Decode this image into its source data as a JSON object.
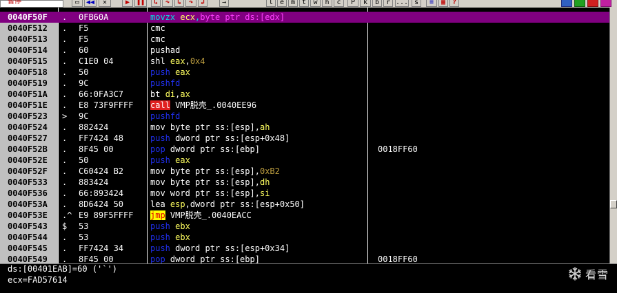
{
  "toolbar": {
    "status": "暂停",
    "buttons": [
      {
        "name": "open-icon",
        "glyph": "▭"
      },
      {
        "name": "rewind-icon",
        "glyph": "◀◀"
      },
      {
        "name": "close-icon",
        "glyph": "✕"
      },
      {
        "name": "run-icon",
        "glyph": "▶"
      },
      {
        "name": "pause-icon",
        "glyph": "❚❚"
      },
      {
        "name": "step-into-icon",
        "glyph": "↳"
      },
      {
        "name": "step-over-icon",
        "glyph": "↷"
      },
      {
        "name": "trace-into-icon",
        "glyph": "↳"
      },
      {
        "name": "trace-over-icon",
        "glyph": "↷"
      },
      {
        "name": "execute-till-return-icon",
        "glyph": "↲"
      },
      {
        "name": "goto-icon",
        "glyph": "→"
      },
      {
        "name": "log-button",
        "glyph": "l"
      },
      {
        "name": "memory-button",
        "glyph": "e"
      },
      {
        "name": "modules-button",
        "glyph": "m"
      },
      {
        "name": "threads-button",
        "glyph": "t"
      },
      {
        "name": "windows-button",
        "glyph": "w"
      },
      {
        "name": "handles-button",
        "glyph": "h"
      },
      {
        "name": "cpu-button",
        "glyph": "c"
      },
      {
        "name": "patches-button",
        "glyph": "P"
      },
      {
        "name": "callstack-button",
        "glyph": "k"
      },
      {
        "name": "breakpoints-button",
        "glyph": "b"
      },
      {
        "name": "references-button",
        "glyph": "r"
      },
      {
        "name": "more-button",
        "glyph": "..."
      },
      {
        "name": "source-button",
        "glyph": "s"
      },
      {
        "name": "options-icon",
        "glyph": "≡"
      },
      {
        "name": "appearance-icon",
        "glyph": "▦"
      },
      {
        "name": "help-icon",
        "glyph": "?"
      }
    ]
  },
  "disasm": {
    "rows": [
      {
        "addr": "0040F50F",
        "mark": ".",
        "hex": "0FB60A",
        "cmt": "",
        "selected": true,
        "cmd": [
          {
            "t": "movzx ",
            "c": "m-cyan"
          },
          {
            "t": "ecx",
            "c": "m-yellow"
          },
          {
            "t": ",",
            "c": "m-cyan"
          },
          {
            "t": "byte ptr ds:[edx]",
            "c": "m-mag"
          }
        ]
      },
      {
        "addr": "0040F512",
        "mark": ".",
        "hex": "F5",
        "cmt": "",
        "cmd": [
          {
            "t": "cmc",
            "c": "m-white"
          }
        ]
      },
      {
        "addr": "0040F513",
        "mark": ".",
        "hex": "F5",
        "cmt": "",
        "cmd": [
          {
            "t": "cmc",
            "c": "m-white"
          }
        ]
      },
      {
        "addr": "0040F514",
        "mark": ".",
        "hex": "60",
        "cmt": "",
        "cmd": [
          {
            "t": "pushad",
            "c": "m-white"
          }
        ]
      },
      {
        "addr": "0040F515",
        "mark": ".",
        "hex": "C1E0 04",
        "cmt": "",
        "cmd": [
          {
            "t": "shl ",
            "c": "m-white"
          },
          {
            "t": "eax",
            "c": "m-yellow"
          },
          {
            "t": ",",
            "c": "m-white"
          },
          {
            "t": "0x4",
            "c": "m-olive"
          }
        ]
      },
      {
        "addr": "0040F518",
        "mark": ".",
        "hex": "50",
        "cmt": "",
        "cmd": [
          {
            "t": "push ",
            "c": "m-blue"
          },
          {
            "t": "eax",
            "c": "m-yellow"
          }
        ]
      },
      {
        "addr": "0040F519",
        "mark": ".",
        "hex": "9C",
        "cmt": "",
        "cmd": [
          {
            "t": "pushfd",
            "c": "m-blue"
          }
        ]
      },
      {
        "addr": "0040F51A",
        "mark": ".",
        "hex": "66:0FA3C7",
        "cmt": "",
        "cmd": [
          {
            "t": "bt ",
            "c": "m-white"
          },
          {
            "t": "di",
            "c": "m-yellow"
          },
          {
            "t": ",",
            "c": "m-white"
          },
          {
            "t": "ax",
            "c": "m-yellow"
          }
        ]
      },
      {
        "addr": "0040F51E",
        "mark": ".",
        "hex": "E8 73F9FFFF",
        "cmt": "",
        "cmd": [
          {
            "t": "call",
            "c": "m-pill-red"
          },
          {
            "t": " VMP脱壳_.0040EE96",
            "c": "m-white"
          }
        ]
      },
      {
        "addr": "0040F523",
        "mark": ">",
        "hex": "9C",
        "cmt": "",
        "cmd": [
          {
            "t": "pushfd",
            "c": "m-blue"
          }
        ]
      },
      {
        "addr": "0040F524",
        "mark": ".",
        "hex": "882424",
        "cmt": "",
        "cmd": [
          {
            "t": "mov ",
            "c": "m-white"
          },
          {
            "t": "byte ptr ss:[esp]",
            "c": "m-white"
          },
          {
            "t": ",",
            "c": "m-white"
          },
          {
            "t": "ah",
            "c": "m-yellow"
          }
        ]
      },
      {
        "addr": "0040F527",
        "mark": ".",
        "hex": "FF7424 48",
        "cmt": "",
        "cmd": [
          {
            "t": "push ",
            "c": "m-blue"
          },
          {
            "t": "dword ptr ss:[esp+0x48]",
            "c": "m-white"
          }
        ]
      },
      {
        "addr": "0040F52B",
        "mark": ".",
        "hex": "8F45 00",
        "cmt": "0018FF60",
        "cmd": [
          {
            "t": "pop ",
            "c": "m-blue"
          },
          {
            "t": "dword ptr ss:[ebp]",
            "c": "m-white"
          }
        ]
      },
      {
        "addr": "0040F52E",
        "mark": ".",
        "hex": "50",
        "cmt": "",
        "cmd": [
          {
            "t": "push ",
            "c": "m-blue"
          },
          {
            "t": "eax",
            "c": "m-yellow"
          }
        ]
      },
      {
        "addr": "0040F52F",
        "mark": ".",
        "hex": "C60424 B2",
        "cmt": "",
        "cmd": [
          {
            "t": "mov ",
            "c": "m-white"
          },
          {
            "t": "byte ptr ss:[esp]",
            "c": "m-white"
          },
          {
            "t": ",",
            "c": "m-white"
          },
          {
            "t": "0xB2",
            "c": "m-olive"
          }
        ]
      },
      {
        "addr": "0040F533",
        "mark": ".",
        "hex": "883424",
        "cmt": "",
        "cmd": [
          {
            "t": "mov ",
            "c": "m-white"
          },
          {
            "t": "byte ptr ss:[esp]",
            "c": "m-white"
          },
          {
            "t": ",",
            "c": "m-white"
          },
          {
            "t": "dh",
            "c": "m-yellow"
          }
        ]
      },
      {
        "addr": "0040F536",
        "mark": ".",
        "hex": "66:893424",
        "cmt": "",
        "cmd": [
          {
            "t": "mov ",
            "c": "m-white"
          },
          {
            "t": "word ptr ss:[esp]",
            "c": "m-white"
          },
          {
            "t": ",",
            "c": "m-white"
          },
          {
            "t": "si",
            "c": "m-yellow"
          }
        ]
      },
      {
        "addr": "0040F53A",
        "mark": ".",
        "hex": "8D6424 50",
        "cmt": "",
        "cmd": [
          {
            "t": "lea ",
            "c": "m-white"
          },
          {
            "t": "esp",
            "c": "m-yellow"
          },
          {
            "t": ",",
            "c": "m-white"
          },
          {
            "t": "dword ptr ss:[esp+0x50]",
            "c": "m-white"
          }
        ]
      },
      {
        "addr": "0040F53E",
        "mark": ".^",
        "hex": "E9 89F5FFFF",
        "cmt": "",
        "cmd": [
          {
            "t": "jmp",
            "c": "m-pill-yellow"
          },
          {
            "t": " VMP脱壳_.0040EACC",
            "c": "m-white"
          }
        ]
      },
      {
        "addr": "0040F543",
        "mark": "$",
        "hex": "53",
        "cmt": "",
        "cmd": [
          {
            "t": "push ",
            "c": "m-blue"
          },
          {
            "t": "ebx",
            "c": "m-yellow"
          }
        ]
      },
      {
        "addr": "0040F544",
        "mark": ".",
        "hex": "53",
        "cmt": "",
        "cmd": [
          {
            "t": "push ",
            "c": "m-blue"
          },
          {
            "t": "ebx",
            "c": "m-yellow"
          }
        ]
      },
      {
        "addr": "0040F545",
        "mark": ".",
        "hex": "FF7424 34",
        "cmt": "",
        "cmd": [
          {
            "t": "push ",
            "c": "m-blue"
          },
          {
            "t": "dword ptr ss:[esp+0x34]",
            "c": "m-white"
          }
        ]
      },
      {
        "addr": "0040F549",
        "mark": ".",
        "hex": "8F45 00",
        "cmt": "0018FF60",
        "cmd": [
          {
            "t": "pop ",
            "c": "m-blue"
          },
          {
            "t": "dword ptr ss:[ebp]",
            "c": "m-white"
          }
        ]
      }
    ]
  },
  "info": {
    "line1": "ds:[00401EAB]=60 ('`')",
    "line2": "ecx=FAD57614"
  },
  "watermark": {
    "text": "看雪"
  }
}
